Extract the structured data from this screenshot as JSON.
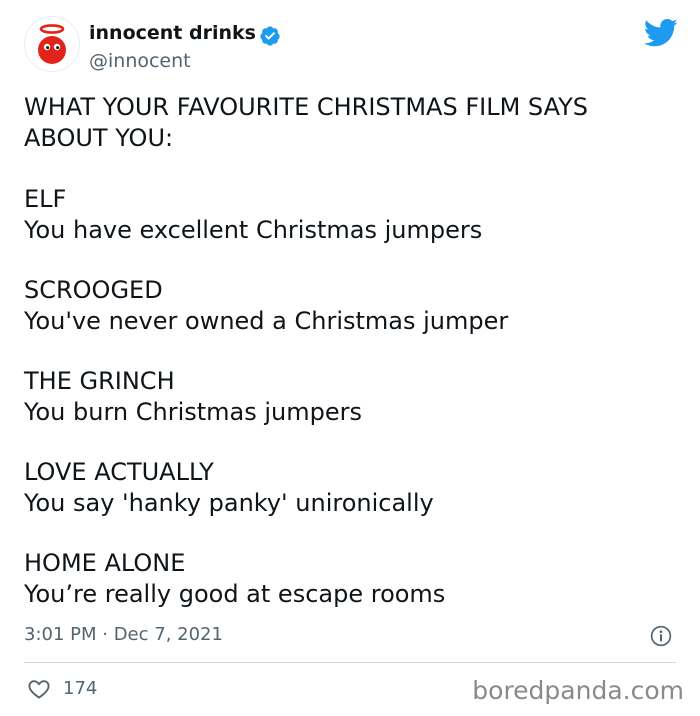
{
  "account": {
    "display_name": "innocent drinks",
    "handle": "@innocent",
    "verified": true
  },
  "tweet": {
    "intro_lines": [
      "WHAT YOUR FAVOURITE CHRISTMAS FILM SAYS",
      "ABOUT YOU:"
    ],
    "films": [
      {
        "title": "ELF",
        "description": "You have excellent Christmas jumpers"
      },
      {
        "title": "SCROOGED",
        "description": "You've never owned a Christmas jumper"
      },
      {
        "title": "THE GRINCH",
        "description": "You burn Christmas jumpers"
      },
      {
        "title": "LOVE ACTUALLY",
        "description": "You say 'hanky panky' unironically"
      },
      {
        "title": "HOME ALONE",
        "description": "You’re really good at escape rooms"
      }
    ],
    "timestamp": "3:01 PM · Dec 7, 2021"
  },
  "engagement": {
    "likes": "174"
  },
  "watermark": "boredpanda.com",
  "colors": {
    "brand_red": "#e2231a",
    "twitter_blue": "#1d9bf0",
    "secondary_text": "#536471"
  },
  "icons": {
    "avatar": "innocent-halo-face-logo",
    "verified": "verified-badge-icon",
    "platform": "twitter-bird-icon",
    "info": "info-icon",
    "like": "heart-outline-icon"
  }
}
